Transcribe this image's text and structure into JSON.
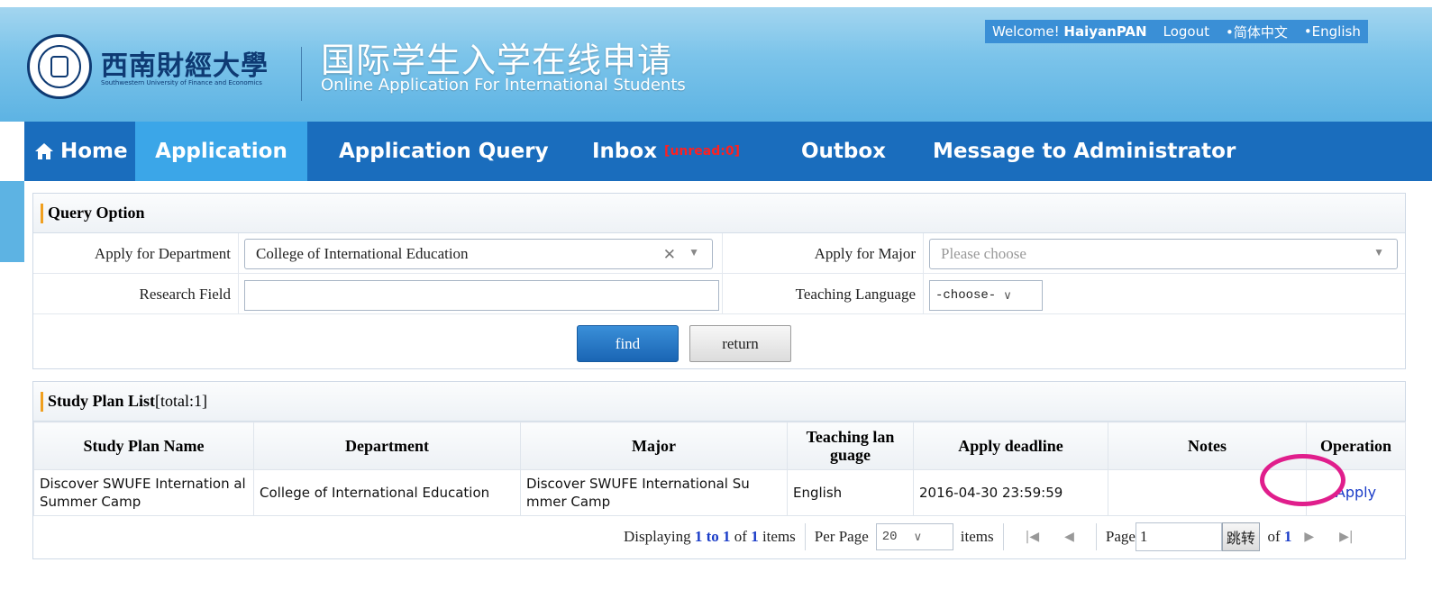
{
  "header": {
    "logo_cn": "西南財經大學",
    "logo_en": "Southwestern University of Finance and Economics",
    "title_cn": "国际学生入学在线申请",
    "title_en": "Online Application For International Students"
  },
  "topbar": {
    "welcome": "Welcome!",
    "username": "HaiyanPAN",
    "logout": "Logout",
    "lang_cn": "•简体中文",
    "lang_en": "•English"
  },
  "nav": {
    "home": "Home",
    "application": "Application",
    "query": "Application Query",
    "inbox": "Inbox",
    "inbox_badge": "[unread:0]",
    "outbox": "Outbox",
    "message": "Message to Administrator"
  },
  "query": {
    "title": "Query Option",
    "dept_label": "Apply for Department",
    "dept_value": "College of International Education",
    "major_label": "Apply for Major",
    "major_placeholder": "Please choose",
    "research_label": "Research Field",
    "research_value": "",
    "lang_label": "Teaching Language",
    "lang_value": "-choose-",
    "find": "find",
    "return": "return"
  },
  "list": {
    "title": "Study Plan List",
    "total": "[total:1]",
    "headers": [
      "Study Plan Name",
      "Department",
      "Major",
      "Teaching lan guage",
      "Apply deadline",
      "Notes",
      "Operation"
    ],
    "rows": [
      {
        "name": "Discover SWUFE Internation al Summer Camp",
        "department": "College of International Education",
        "major": "Discover SWUFE International Su mmer Camp",
        "language": "English",
        "deadline": "2016-04-30 23:59:59",
        "notes": "",
        "operation": "Apply"
      }
    ]
  },
  "pager": {
    "displaying": "Displaying",
    "from_to": "1 to 1",
    "of": "of",
    "total": "1",
    "items": "items",
    "per_page": "Per Page",
    "per_page_value": "20",
    "items2": "items",
    "page": "Page",
    "page_value": "1",
    "goto": "跳转",
    "of2": "of",
    "page_total": "1"
  },
  "colors": {
    "nav": "#1a6dbd",
    "nav_active": "#3ba6e8",
    "highlight_ring": "#e01e8c",
    "link": "#1a3cc8"
  }
}
